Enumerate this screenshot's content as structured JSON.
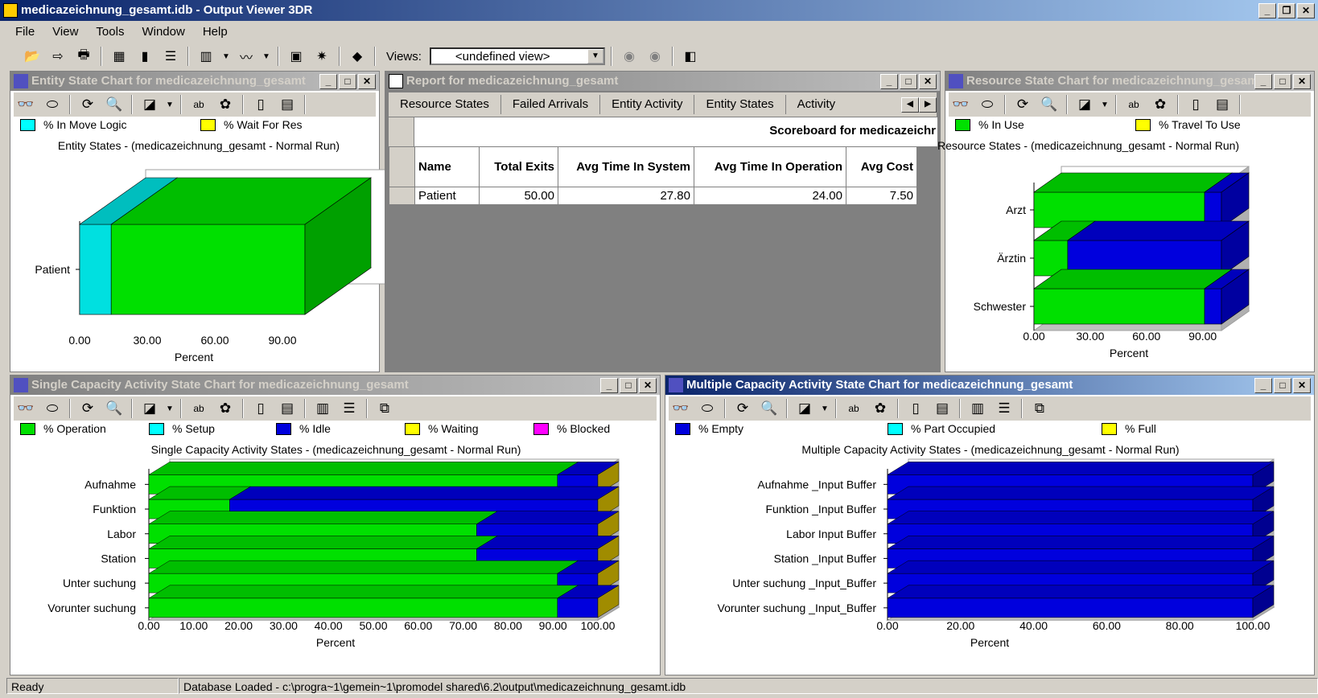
{
  "app": {
    "title": "medicazeichnung_gesamt.idb - Output Viewer 3DR",
    "menu": [
      "File",
      "View",
      "Tools",
      "Window",
      "Help"
    ],
    "views_label": "Views:",
    "views_value": "<undefined view>",
    "status_ready": "Ready",
    "status_message": "Database Loaded - c:\\progra~1\\gemein~1\\promodel shared\\6.2\\output\\medicazeichnung_gesamt.idb"
  },
  "colors": {
    "green": "#00e000",
    "blue": "#0000dd",
    "cyan": "#00ffff",
    "yellow": "#ffff00",
    "magenta": "#ff00ff",
    "grid_bg": "#808080"
  },
  "entity_panel": {
    "title": "Entity State Chart for medicazeichnung_gesamt",
    "legend": [
      {
        "label": "% In Move Logic",
        "color": "#00ffff"
      },
      {
        "label": "% Wait For Res",
        "color": "#ffff00"
      }
    ],
    "chart_title": "Entity States - (medicazeichnung_gesamt - Normal Run)",
    "xlabel": "Percent",
    "ticks": [
      "0.00",
      "30.00",
      "60.00",
      "90.00"
    ]
  },
  "report_panel": {
    "title": "Report for medicazeichnung_gesamt",
    "tabs": [
      "Resource States",
      "Failed Arrivals",
      "Entity Activity",
      "Entity States",
      "Activity"
    ],
    "scoreboard_title": "Scoreboard for medicazeichr",
    "columns": [
      "Name",
      "Total Exits",
      "Avg Time In System",
      "Avg Time In Operation",
      "Avg Cost"
    ],
    "row": [
      "Patient",
      "50.00",
      "27.80",
      "24.00",
      "7.50"
    ]
  },
  "resource_panel": {
    "title": "Resource State Chart for medicazeichnung_gesamt",
    "legend": [
      {
        "label": "% In Use",
        "color": "#00e000"
      },
      {
        "label": "% Travel To Use",
        "color": "#ffff00"
      }
    ],
    "chart_title": "Resource States - (medicazeichnung_gesamt - Normal Run)",
    "xlabel": "Percent",
    "ticks": [
      "0.00",
      "30.00",
      "60.00",
      "90.00"
    ]
  },
  "single_panel": {
    "title": "Single Capacity Activity State Chart for medicazeichnung_gesamt",
    "legend": [
      {
        "label": "% Operation",
        "color": "#00e000"
      },
      {
        "label": "% Setup",
        "color": "#00ffff"
      },
      {
        "label": "% Idle",
        "color": "#0000dd"
      },
      {
        "label": "% Waiting",
        "color": "#ffff00"
      },
      {
        "label": "% Blocked",
        "color": "#ff00ff"
      }
    ],
    "chart_title": "Single Capacity Activity States - (medicazeichnung_gesamt - Normal Run)",
    "xlabel": "Percent",
    "ticks": [
      "0.00",
      "10.00",
      "20.00",
      "30.00",
      "40.00",
      "50.00",
      "60.00",
      "70.00",
      "80.00",
      "90.00",
      "100.00"
    ]
  },
  "multi_panel": {
    "title": "Multiple Capacity Activity State Chart for medicazeichnung_gesamt",
    "legend": [
      {
        "label": "% Empty",
        "color": "#0000dd"
      },
      {
        "label": "% Part Occupied",
        "color": "#00ffff"
      },
      {
        "label": "% Full",
        "color": "#ffff00"
      }
    ],
    "chart_title": "Multiple Capacity Activity States - (medicazeichnung_gesamt - Normal Run)",
    "xlabel": "Percent",
    "ticks": [
      "0.00",
      "20.00",
      "40.00",
      "60.00",
      "80.00",
      "100.00"
    ]
  },
  "chart_data": [
    {
      "type": "bar",
      "title": "Entity States - (medicazeichnung_gesamt - Normal Run)",
      "xlabel": "Percent",
      "categories": [
        "Patient"
      ],
      "series": [
        {
          "name": "% In Move Logic",
          "values": [
            14
          ]
        },
        {
          "name": "% Wait For Res",
          "values": [
            86
          ]
        }
      ],
      "xlim": [
        0,
        100
      ]
    },
    {
      "type": "bar",
      "title": "Resource States - (medicazeichnung_gesamt - Normal Run)",
      "xlabel": "Percent",
      "categories": [
        "Arzt",
        "Ärztin",
        "Schwester"
      ],
      "series": [
        {
          "name": "% In Use",
          "values": [
            91,
            18,
            91
          ]
        },
        {
          "name": "% Travel To Use",
          "values": [
            9,
            82,
            9
          ]
        }
      ],
      "xlim": [
        0,
        100
      ]
    },
    {
      "type": "bar",
      "title": "Single Capacity Activity States - (medicazeichnung_gesamt - Normal Run)",
      "xlabel": "Percent",
      "categories": [
        "Aufnahme",
        "Funktion",
        "Labor",
        "Station",
        "Unter suchung",
        "Vorunter suchung"
      ],
      "series": [
        {
          "name": "% Operation",
          "values": [
            91,
            18,
            73,
            73,
            91,
            91
          ]
        },
        {
          "name": "% Idle",
          "values": [
            9,
            82,
            27,
            27,
            9,
            9
          ]
        }
      ],
      "xlim": [
        0,
        100
      ]
    },
    {
      "type": "bar",
      "title": "Multiple Capacity Activity States - (medicazeichnung_gesamt - Normal Run)",
      "xlabel": "Percent",
      "categories": [
        "Aufnahme _Input Buffer",
        "Funktion _Input Buffer",
        "Labor Input Buffer",
        "Station _Input Buffer",
        "Unter suchung _Input_Buffer",
        "Vorunter suchung _Input_Buffer"
      ],
      "series": [
        {
          "name": "% Empty",
          "values": [
            100,
            100,
            100,
            100,
            100,
            100
          ]
        }
      ],
      "xlim": [
        0,
        100
      ]
    }
  ]
}
